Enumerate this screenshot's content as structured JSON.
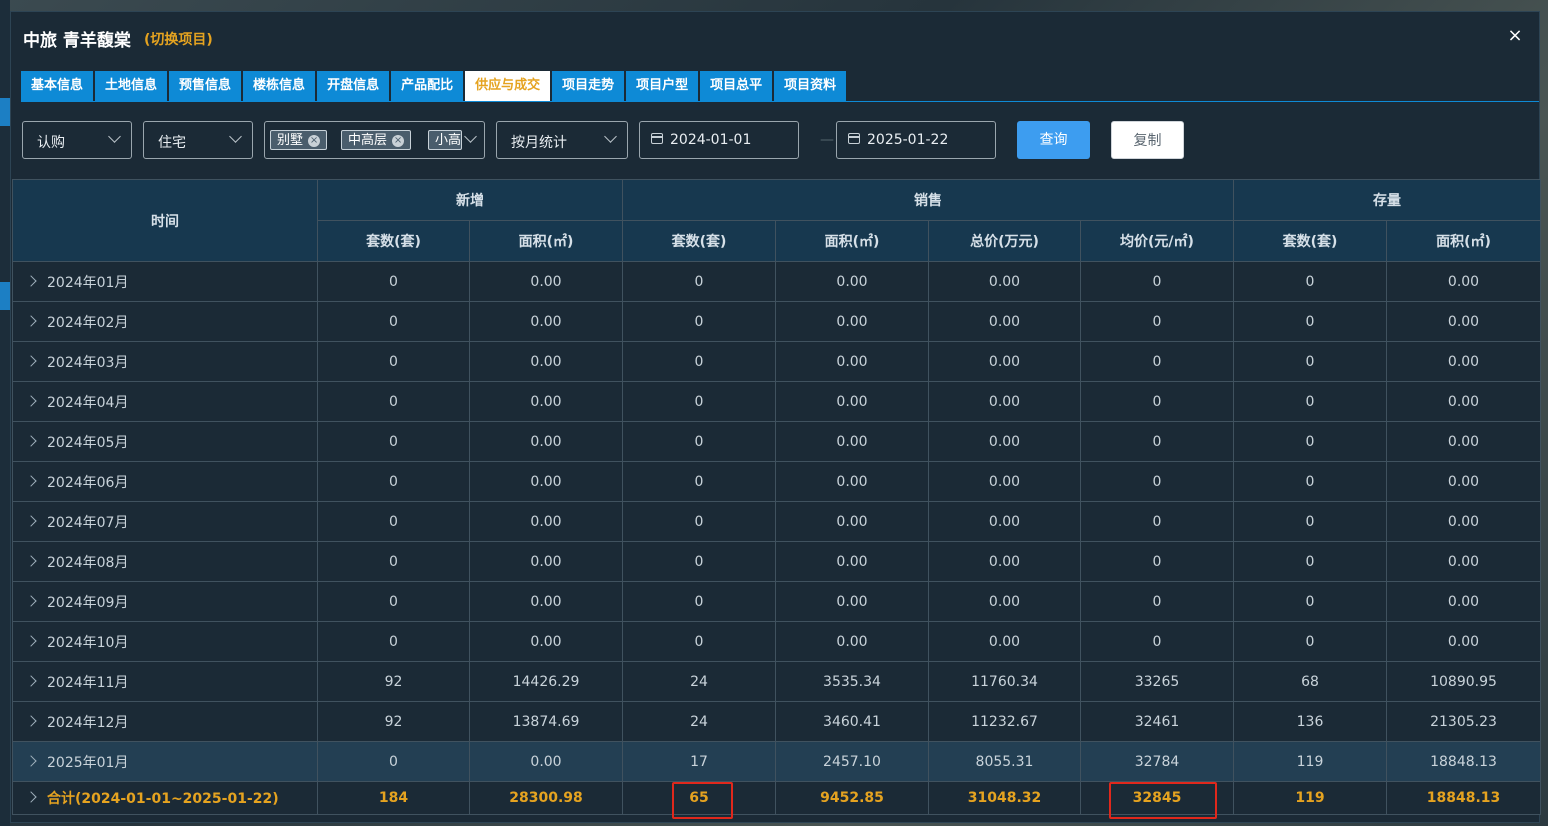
{
  "window": {
    "title": "中旅 青羊馥棠",
    "switch_label": "(切换项目)",
    "close_label": "×"
  },
  "tabs": [
    {
      "label": "基本信息"
    },
    {
      "label": "土地信息"
    },
    {
      "label": "预售信息"
    },
    {
      "label": "楼栋信息"
    },
    {
      "label": "开盘信息"
    },
    {
      "label": "产品配比"
    },
    {
      "label": "供应与成交",
      "active": true
    },
    {
      "label": "项目走势"
    },
    {
      "label": "项目户型"
    },
    {
      "label": "项目总平"
    },
    {
      "label": "项目资料"
    }
  ],
  "filters": {
    "status_select": "认购",
    "type_select": "住宅",
    "tags": [
      "别墅",
      "中高层",
      "小高"
    ],
    "period_select": "按月统计",
    "start_date": "2024-01-01",
    "end_date": "2025-01-22",
    "query_button": "查询",
    "copy_button": "复制"
  },
  "table": {
    "time_header": "时间",
    "groups": [
      "新增",
      "销售",
      "存量"
    ],
    "columns": [
      "套数(套)",
      "面积(㎡)",
      "套数(套)",
      "面积(㎡)",
      "总价(万元)",
      "均价(元/㎡)",
      "套数(套)",
      "面积(㎡)"
    ],
    "rows": [
      {
        "time": "2024年01月",
        "cells": [
          "0",
          "0.00",
          "0",
          "0.00",
          "0.00",
          "0",
          "0",
          "0.00"
        ]
      },
      {
        "time": "2024年02月",
        "cells": [
          "0",
          "0.00",
          "0",
          "0.00",
          "0.00",
          "0",
          "0",
          "0.00"
        ]
      },
      {
        "time": "2024年03月",
        "cells": [
          "0",
          "0.00",
          "0",
          "0.00",
          "0.00",
          "0",
          "0",
          "0.00"
        ]
      },
      {
        "time": "2024年04月",
        "cells": [
          "0",
          "0.00",
          "0",
          "0.00",
          "0.00",
          "0",
          "0",
          "0.00"
        ]
      },
      {
        "time": "2024年05月",
        "cells": [
          "0",
          "0.00",
          "0",
          "0.00",
          "0.00",
          "0",
          "0",
          "0.00"
        ]
      },
      {
        "time": "2024年06月",
        "cells": [
          "0",
          "0.00",
          "0",
          "0.00",
          "0.00",
          "0",
          "0",
          "0.00"
        ]
      },
      {
        "time": "2024年07月",
        "cells": [
          "0",
          "0.00",
          "0",
          "0.00",
          "0.00",
          "0",
          "0",
          "0.00"
        ]
      },
      {
        "time": "2024年08月",
        "cells": [
          "0",
          "0.00",
          "0",
          "0.00",
          "0.00",
          "0",
          "0",
          "0.00"
        ]
      },
      {
        "time": "2024年09月",
        "cells": [
          "0",
          "0.00",
          "0",
          "0.00",
          "0.00",
          "0",
          "0",
          "0.00"
        ]
      },
      {
        "time": "2024年10月",
        "cells": [
          "0",
          "0.00",
          "0",
          "0.00",
          "0.00",
          "0",
          "0",
          "0.00"
        ]
      },
      {
        "time": "2024年11月",
        "cells": [
          "92",
          "14426.29",
          "24",
          "3535.34",
          "11760.34",
          "33265",
          "68",
          "10890.95"
        ]
      },
      {
        "time": "2024年12月",
        "cells": [
          "92",
          "13874.69",
          "24",
          "3460.41",
          "11232.67",
          "32461",
          "136",
          "21305.23"
        ]
      },
      {
        "time": "2025年01月",
        "cells": [
          "0",
          "0.00",
          "17",
          "2457.10",
          "8055.31",
          "32784",
          "119",
          "18848.13"
        ],
        "highlight": true
      }
    ],
    "total": {
      "time": "合计(2024-01-01~2025-01-22)",
      "cells": [
        "184",
        "28300.98",
        "65",
        "9452.85",
        "31048.32",
        "32845",
        "119",
        "18848.13"
      ]
    }
  },
  "colors": {
    "accent_blue": "#0e8ad6",
    "highlight_orange": "#e5a320",
    "annotation_red": "#e0281c"
  }
}
